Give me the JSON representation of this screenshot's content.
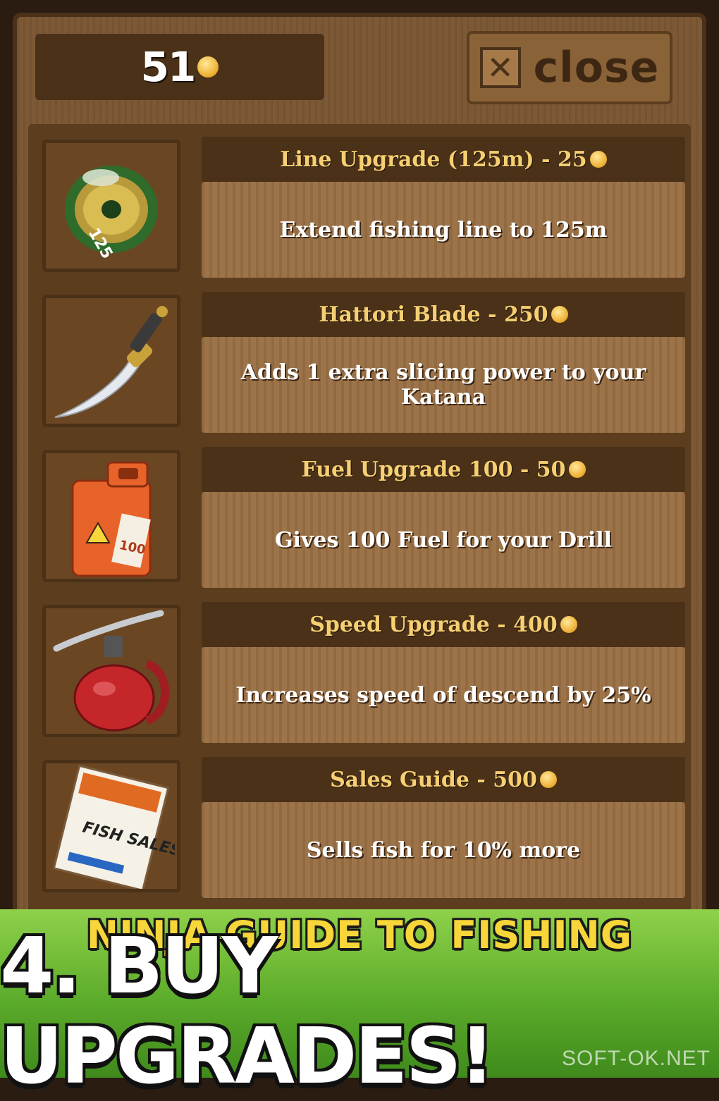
{
  "header": {
    "coins": "51",
    "close_label": "close"
  },
  "items": [
    {
      "title": "Line Upgrade (125m) - 25",
      "description": "Extend fishing line to 125m",
      "icon": "fishing-line-spool-icon",
      "icon_text": "125"
    },
    {
      "title": "Hattori Blade - 250",
      "description": "Adds 1 extra slicing power to your Katana",
      "icon": "katana-blade-icon"
    },
    {
      "title": "Fuel Upgrade 100 - 50",
      "description": "Gives 100 Fuel for your Drill",
      "icon": "fuel-can-icon",
      "icon_text": "100"
    },
    {
      "title": "Speed Upgrade - 400",
      "description": "Increases speed of descend by 25%",
      "icon": "oil-can-icon"
    },
    {
      "title": "Sales Guide - 500",
      "description": "Sells fish for 10% more",
      "icon": "sales-magazine-icon",
      "icon_text": "FISH SALES"
    }
  ],
  "banner": {
    "subtitle": "NINJA GUIDE TO FISHING",
    "title": "4. BUY UPGRADES!"
  },
  "watermark": "SOFT-OK.NET",
  "colors": {
    "wood_light": "#9a7044",
    "wood_dark": "#4a3118",
    "gold_text": "#f6cf72",
    "banner_green": "#5bab2a",
    "banner_yellow": "#f7d63a"
  }
}
